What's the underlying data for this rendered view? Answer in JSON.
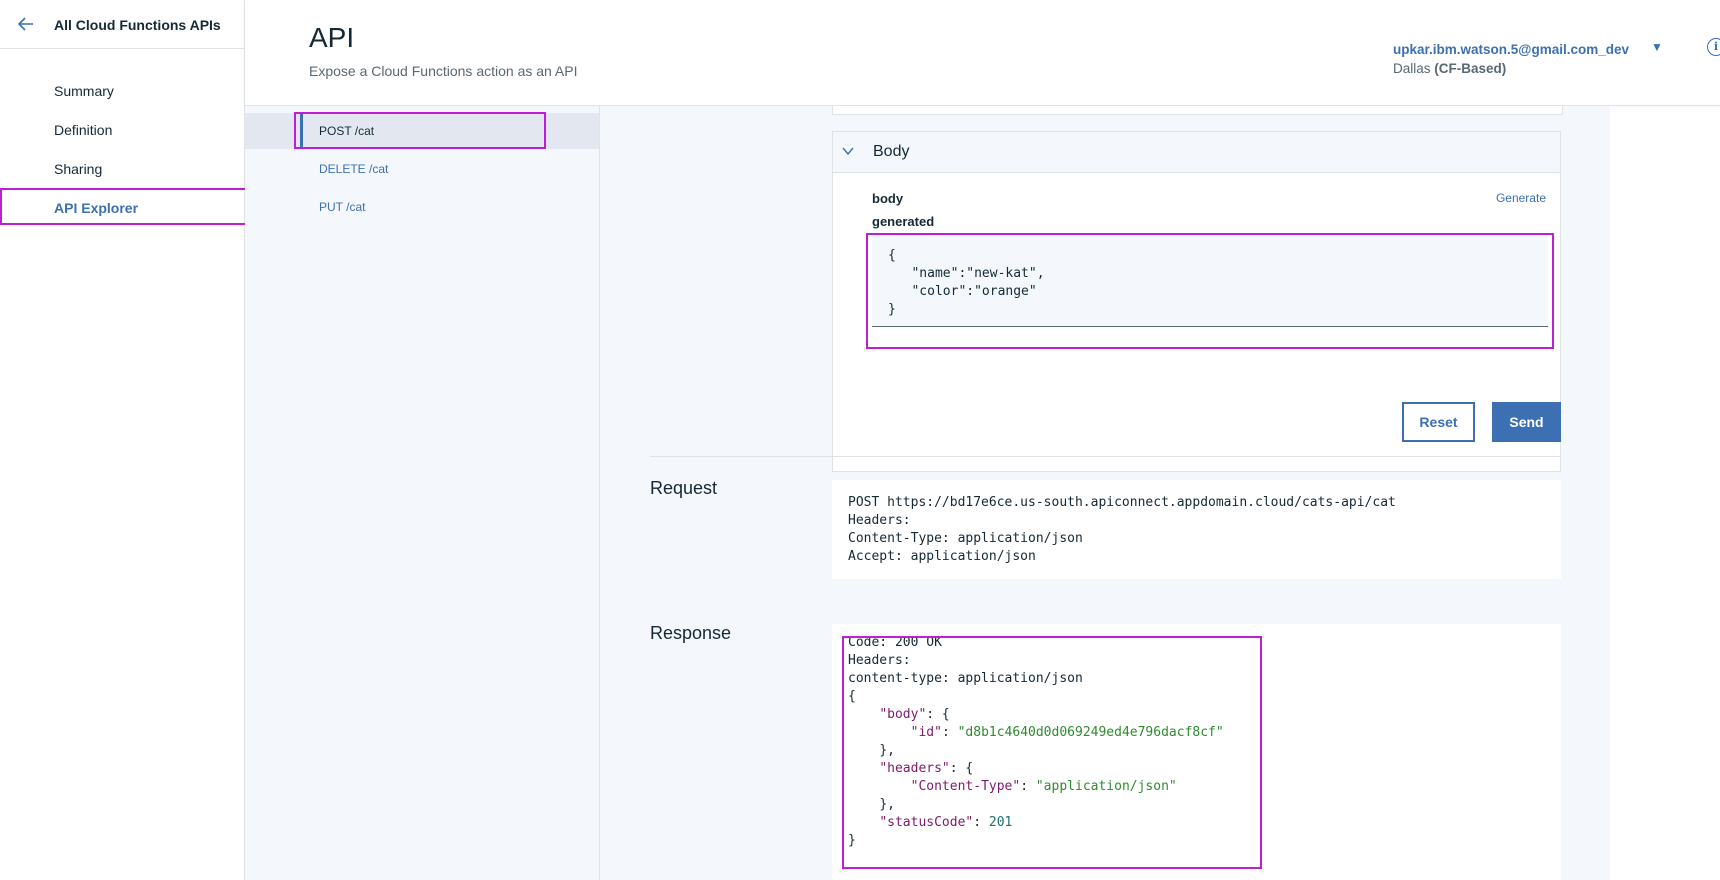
{
  "sidebar": {
    "back_icon": "arrow-left-icon",
    "title": "All Cloud Functions APIs",
    "items": [
      {
        "label": "Summary"
      },
      {
        "label": "Definition"
      },
      {
        "label": "Sharing"
      },
      {
        "label": "API Explorer",
        "active": true
      }
    ]
  },
  "header": {
    "title": "API",
    "subtitle": "Expose a Cloud Functions action as an API",
    "account": "upkar.ibm.watson.5@gmail.com_dev",
    "region_name": "Dallas",
    "region_type": "(CF-Based)",
    "info_icon": "info-icon"
  },
  "operations": [
    {
      "label": "POST /cat",
      "active": true
    },
    {
      "label": "DELETE /cat"
    },
    {
      "label": "PUT /cat"
    }
  ],
  "body_section": {
    "title": "Body",
    "param_label": "body",
    "generate_label": "Generate",
    "generated_label": "generated",
    "editor_value": "{\n   \"name\":\"new-kat\",\n   \"color\":\"orange\"\n}"
  },
  "buttons": {
    "reset_label": "Reset",
    "send_label": "Send"
  },
  "request": {
    "label": "Request",
    "text": "POST https://bd17e6ce.us-south.apiconnect.appdomain.cloud/cats-api/cat\nHeaders:\nContent-Type: application/json\nAccept: application/json"
  },
  "response": {
    "label": "Response",
    "code_line": "Code: 200 OK",
    "headers_line": "Headers:",
    "content_type_line": "content-type: application/json",
    "json": {
      "open": "{",
      "body_key": "\"body\"",
      "body_open": ": {",
      "id_key": "\"id\"",
      "id_value": "\"d8b1c4640d0d069249ed4e796dacf8cf\"",
      "body_close": "},",
      "headers_key": "\"headers\"",
      "headers_open": ": {",
      "ct_key": "\"Content-Type\"",
      "ct_value": "\"application/json\"",
      "headers_close": "},",
      "status_key": "\"statusCode\"",
      "status_value": "201",
      "close": "}"
    }
  },
  "colors": {
    "accent": "#3d70b2",
    "highlight": "#c11cd6",
    "json_key": "#7d1a6b",
    "json_string": "#2e8b2e"
  }
}
